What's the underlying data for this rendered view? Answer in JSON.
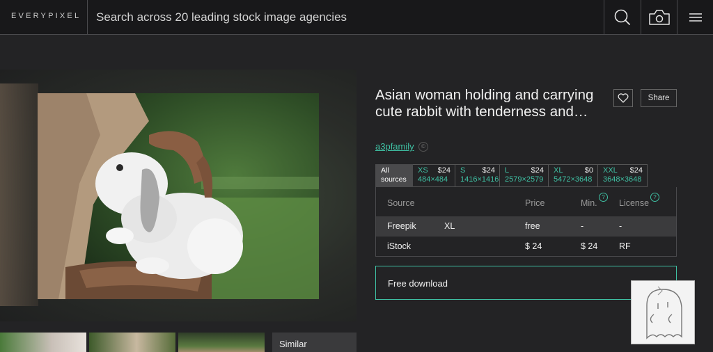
{
  "header": {
    "logo": "EVERYPIXEL",
    "search_placeholder": "Search across 20 leading stock image agencies",
    "icons": [
      "search-icon",
      "camera-icon",
      "menu-icon"
    ]
  },
  "image": {
    "title": "Asian woman holding and carrying cute rabbit with tenderness and…",
    "author": "a3pfamily"
  },
  "actions": {
    "share": "Share"
  },
  "sizes": {
    "all_line1": "All",
    "all_line2": "sources",
    "tabs": [
      {
        "label": "XS",
        "price": "$24",
        "dims": "484×484"
      },
      {
        "label": "S",
        "price": "$24",
        "dims": "1416×1416"
      },
      {
        "label": "L",
        "price": "$24",
        "dims": "2579×2579"
      },
      {
        "label": "XL",
        "price": "$0",
        "dims": "5472×3648"
      },
      {
        "label": "XXL",
        "price": "$24",
        "dims": "3648×3648"
      }
    ]
  },
  "table": {
    "headers": {
      "source": "Source",
      "price": "Price",
      "min": "Min.",
      "license": "License"
    },
    "rows": [
      {
        "source": "Freepik",
        "size": "XL",
        "price": "free",
        "min": "-",
        "license": "-"
      },
      {
        "source": "iStock",
        "size": "",
        "price": "$ 24",
        "min": "$ 24",
        "license": "RF"
      }
    ]
  },
  "download": {
    "label": "Free download"
  },
  "similar": {
    "label": "Similar"
  },
  "colors": {
    "accent": "#3fc0a3",
    "background": "#232325",
    "header": "#18181a"
  }
}
